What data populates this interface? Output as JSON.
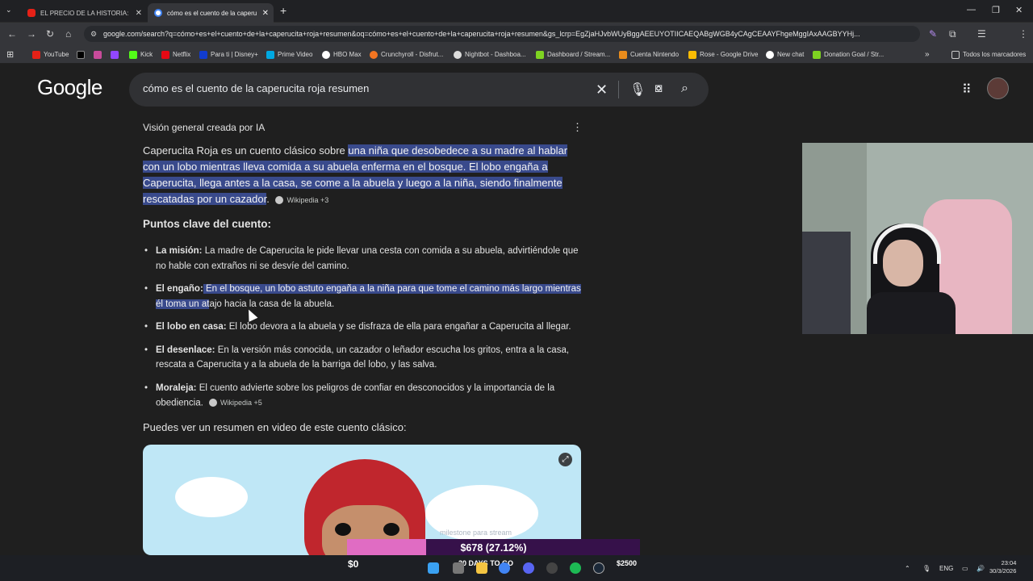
{
  "browser": {
    "tabs": [
      {
        "title": "EL PRECIO DE LA HISTORIA: NI",
        "favicon": "youtube-icon",
        "active": false
      },
      {
        "title": "cómo es el cuento de la caperu",
        "favicon": "google-icon",
        "active": true
      }
    ],
    "new_tab": "+",
    "url": "google.com/search?q=cómo+es+el+cuento+de+la+caperucita+roja+resumen&oq=cómo+es+el+cuento+de+la+caperucita+roja+resumen&gs_lcrp=EgZjaHJvbWUyBggAEEUYOTIICAEQABgWGB4yCAgCEAAYFhgeMggIAxAAGBYYHj...",
    "bookmarks": [
      "YouTube",
      "X",
      "",
      "",
      "Kick",
      "Netflix",
      "Para ti | Disney+",
      "Prime Video",
      "HBO Max",
      "Crunchyroll - Disfrut...",
      "Nightbot - Dashboa...",
      "Dashboard / Stream...",
      "Cuenta Nintendo",
      "Rose - Google Drive",
      "New chat",
      "Donation Goal / Str..."
    ],
    "bookmarks_more": "»",
    "all_bookmarks": "Todos los marcadores"
  },
  "google": {
    "logo": "Google",
    "query": "cómo es el cuento de la caperucita roja resumen",
    "ai_overview_label": "Visión general creada por IA",
    "summary_plain": "Caperucita Roja es un cuento clásico sobre ",
    "summary_highlight": "una niña que desobedece a su madre al hablar con un lobo mientras lleva comida a su abuela enferma en el bosque. El lobo engaña a Caperucita, llega antes a la casa, se come a la abuela y luego a la niña, siendo finalmente rescatadas por un cazador",
    "summary_end": ".",
    "summary_source": "Wikipedia +3",
    "key_points_title": "Puntos clave del cuento:",
    "points": [
      {
        "label": "La misión:",
        "text": " La madre de Caperucita le pide llevar una cesta con comida a su abuela, advirtiéndole que no hable con extraños ni se desvíe del camino."
      },
      {
        "label": "El engaño:",
        "pre": " E",
        "highlight": "n el bosque, un lobo astuto engaña a la niña para que tome el camino más largo mientras él toma un at",
        "text": "ajo hacia la casa de la abuela."
      },
      {
        "label": "El lobo en casa:",
        "text": " El lobo devora a la abuela y se disfraza de ella para engañar a Caperucita al llegar."
      },
      {
        "label": "El desenlace:",
        "text": " En la versión más conocida, un cazador o leñador escucha los gritos, entra a la casa, rescata a Caperucita y a la abuela de la barriga del lobo, y las salva."
      },
      {
        "label": "Moraleja:",
        "text": " El cuento advierte sobre los peligros de confiar en desconocidos y la importancia de la obediencia.",
        "source": "Wikipedia +5"
      }
    ],
    "video_heading": "Puedes ver un resumen en video de este cuento clásico:"
  },
  "overlay": {
    "goal_text": "$678 (27.12%)",
    "goal_fraction": 0.2712,
    "goal_start": "$0",
    "goal_mid": "30 DAYS TO GO",
    "goal_end": "$2500",
    "goal_caption": "milestone para stream"
  },
  "taskbar": {
    "lang": "ENG",
    "time": "23:04",
    "date": "30/3/2026"
  }
}
